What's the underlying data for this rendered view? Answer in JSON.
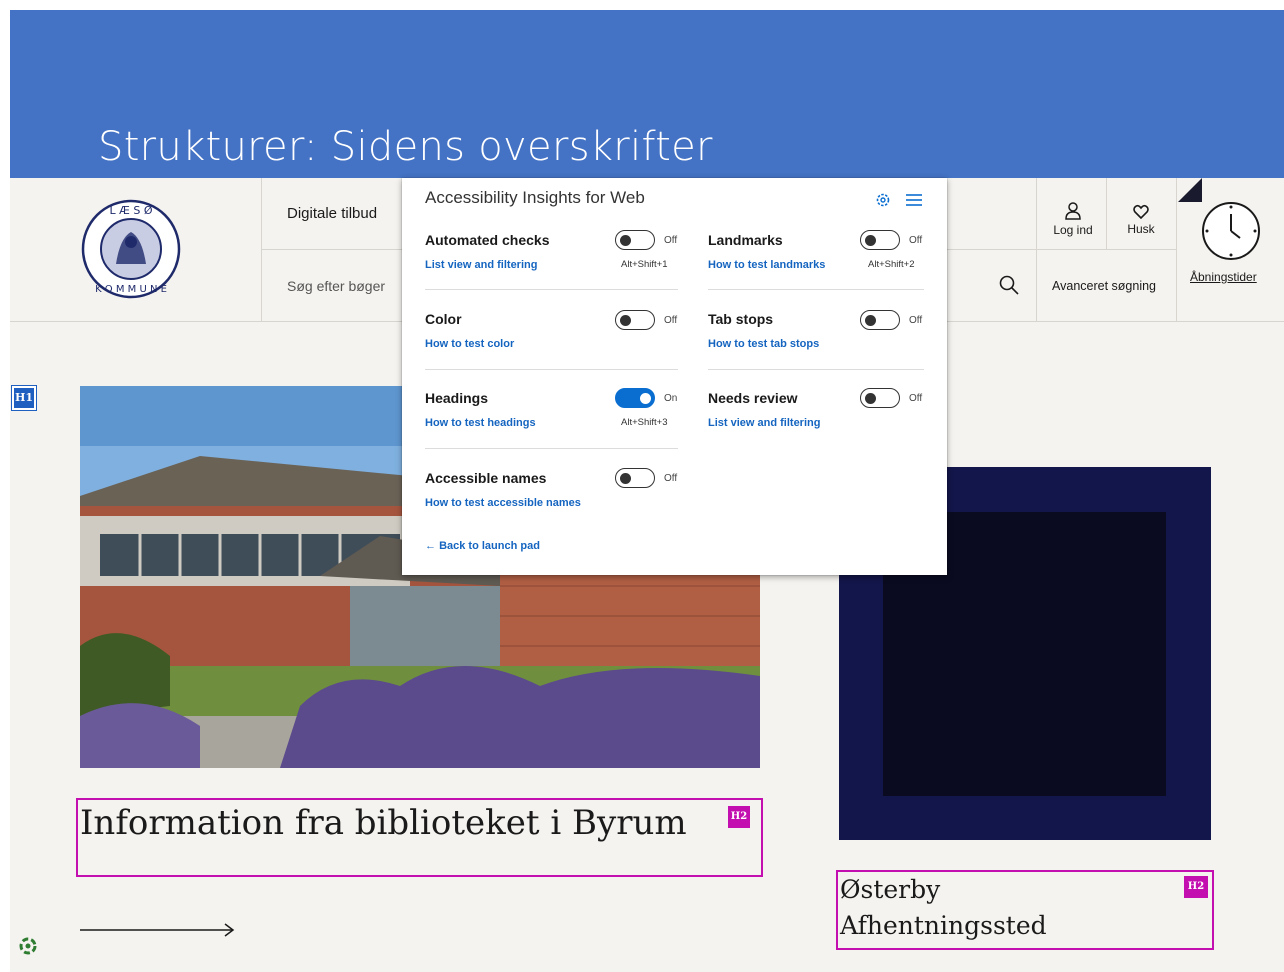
{
  "slide": {
    "title": "Strukturer: Sidens overskrifter"
  },
  "site": {
    "nav_link": "Digitale tilbud",
    "search_placeholder": "Søg efter bøger",
    "login_label": "Log ind",
    "favorites_label": "Husk",
    "advanced_search": "Avanceret søgning",
    "opening_hours": "Åbningstider",
    "logo_text": "LÆSØ KOMMUNE",
    "h1_badge": "H1",
    "h2_badge": "H2",
    "article1_title": "Information fra biblioteket i Byrum",
    "article2_title": "Østerby Afhentningssted"
  },
  "panel": {
    "title": "Accessibility Insights for Web",
    "back_link": "Back to launch pad",
    "items": [
      {
        "title": "Automated checks",
        "link": "List view and filtering",
        "shortcut": "Alt+Shift+1",
        "state": "Off"
      },
      {
        "title": "Landmarks",
        "link": "How to test landmarks",
        "shortcut": "Alt+Shift+2",
        "state": "Off"
      },
      {
        "title": "Color",
        "link": "How to test color",
        "shortcut": "",
        "state": "Off"
      },
      {
        "title": "Tab stops",
        "link": "How to test tab stops",
        "shortcut": "",
        "state": "Off"
      },
      {
        "title": "Headings",
        "link": "How to test headings",
        "shortcut": "Alt+Shift+3",
        "state": "On"
      },
      {
        "title": "Needs review",
        "link": "List view and filtering",
        "shortcut": "",
        "state": "Off"
      },
      {
        "title": "Accessible names",
        "link": "How to test accessible names",
        "shortcut": "",
        "state": "Off"
      }
    ]
  },
  "colors": {
    "banner": "#4472c4",
    "heading_highlight": "#c40fb0",
    "h1_badge": "#1e5fbf",
    "link_blue": "#1565c0"
  }
}
